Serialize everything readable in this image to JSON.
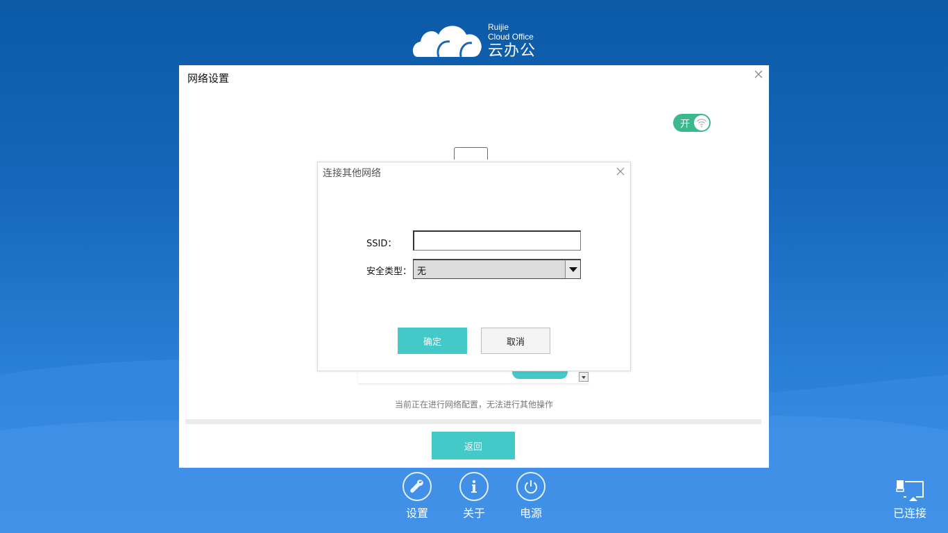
{
  "logo": {
    "brand": "Ruijie",
    "product": "Cloud Office",
    "product_cn": "云办公"
  },
  "main_dialog": {
    "title": "网络设置",
    "wifi_toggle_label": "开",
    "wifi_toggle_on": true,
    "status_message": "当前正在进行网络配置，无法进行其他操作",
    "back_button": "返回"
  },
  "sub_dialog": {
    "title": "连接其他网络",
    "ssid_label": "SSID：",
    "ssid_value": "",
    "security_label": "安全类型：",
    "security_value": "无",
    "ok_button": "确定",
    "cancel_button": "取消"
  },
  "toolbar": {
    "settings": "设置",
    "about": "关于",
    "power": "电源"
  },
  "connection": {
    "status": "已连接"
  },
  "colors": {
    "accent": "#43c9c7",
    "toggle_on": "#3bb98c",
    "background_top": "#0b5aa6",
    "background_bottom": "#3d8fe6"
  }
}
